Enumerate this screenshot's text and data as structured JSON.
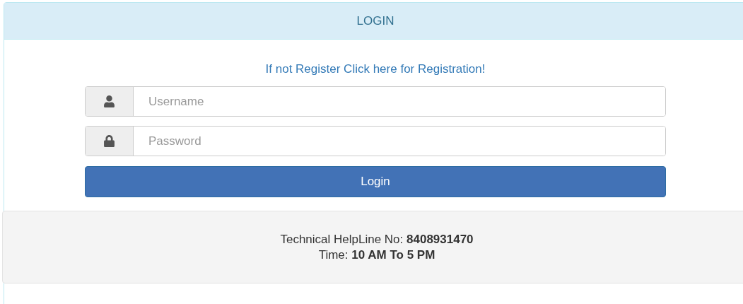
{
  "panel": {
    "title": "LOGIN"
  },
  "register_link": "If not Register Click here for Registration!",
  "fields": [
    {
      "kind": "user",
      "placeholder": "Username"
    },
    {
      "kind": "lock",
      "placeholder": "Password"
    }
  ],
  "login_button": "Login",
  "footer": {
    "helpline": "Technical HelpLine No: **8408931470**",
    "time": "Time: **10 AM To 5 PM**"
  }
}
